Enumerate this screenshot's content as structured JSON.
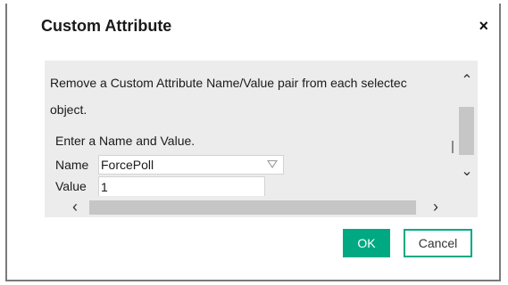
{
  "dialog": {
    "title": "Custom Attribute",
    "close_glyph": "×"
  },
  "content": {
    "description_line1": "Remove a Custom Attribute Name/Value pair from each selectec",
    "description_line2": "object.",
    "form_intro": "Enter a Name and Value.",
    "name_label": "Name",
    "name_value": "ForcePoll",
    "value_label": "Value",
    "value_value": "1"
  },
  "scrollbars": {
    "up_glyph": "⌃",
    "down_glyph": "⌄",
    "left_glyph": "‹",
    "right_glyph": "›"
  },
  "buttons": {
    "ok_label": "OK",
    "cancel_label": "Cancel"
  },
  "colors": {
    "accent": "#01a982",
    "panel_bg": "#ececec"
  }
}
